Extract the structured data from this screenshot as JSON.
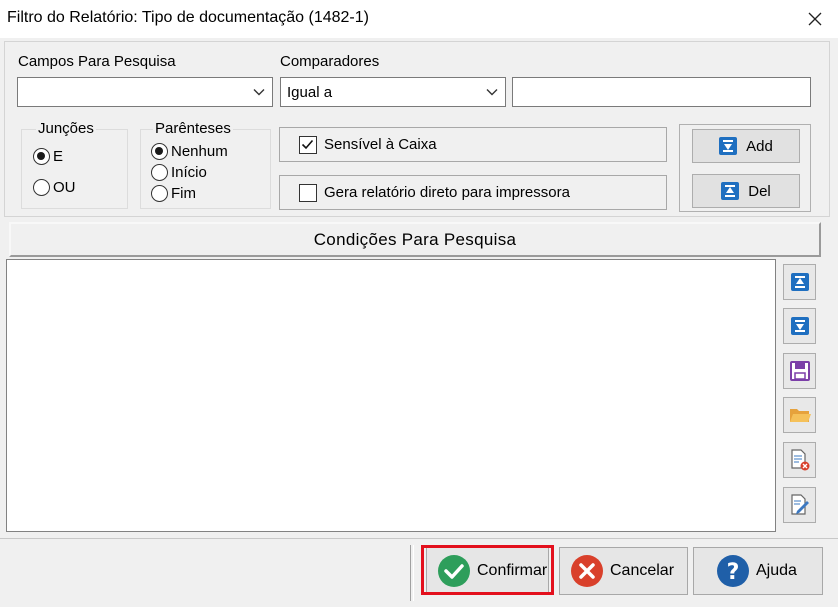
{
  "window": {
    "title": "Filtro do Relatório: Tipo de documentação (1482-1)"
  },
  "fields": {
    "campos_label": "Campos Para Pesquisa",
    "campos_value": "",
    "comparadores_label": "Comparadores",
    "comparadores_value": "Igual a",
    "value_input": ""
  },
  "juncoes": {
    "title": "Junções",
    "options": [
      {
        "label": "E",
        "selected": true
      },
      {
        "label": "OU",
        "selected": false
      }
    ]
  },
  "parenteses": {
    "title": "Parênteses",
    "options": [
      {
        "label": "Nenhum",
        "selected": true
      },
      {
        "label": "Início",
        "selected": false
      },
      {
        "label": "Fim",
        "selected": false
      }
    ]
  },
  "options": {
    "case_sensitive_label": "Sensível à Caixa",
    "case_sensitive_checked": true,
    "direct_print_label": "Gera relatório direto para impressora",
    "direct_print_checked": false
  },
  "actions": {
    "add_label": "Add",
    "del_label": "Del"
  },
  "conditions": {
    "header": "Condições Para Pesquisa",
    "items": []
  },
  "side_tools": [
    "move-up-icon",
    "move-down-icon",
    "save-icon",
    "open-folder-icon",
    "delete-document-icon",
    "edit-document-icon"
  ],
  "footer": {
    "confirm_label": "Confirmar",
    "cancel_label": "Cancelar",
    "help_label": "Ajuda"
  },
  "colors": {
    "accent_blue": "#1f6fc0",
    "confirm_green": "#2e9e5b",
    "cancel_red": "#d9402b",
    "highlight_red": "#e3101d"
  }
}
